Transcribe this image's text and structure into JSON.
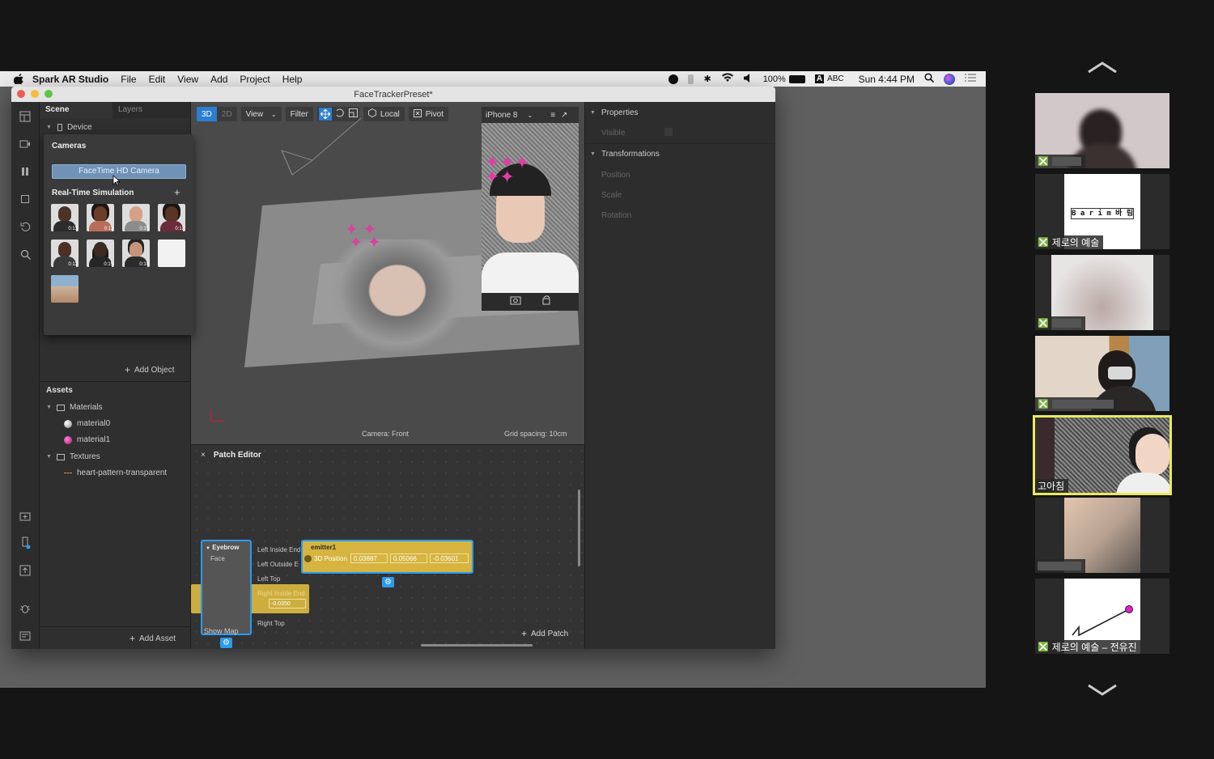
{
  "menubar": {
    "app_name": "Spark AR Studio",
    "menus": [
      "File",
      "Edit",
      "View",
      "Add",
      "Project",
      "Help"
    ],
    "battery": "100%",
    "input_method": "ABC",
    "clock": "Sun 4:44 PM"
  },
  "window": {
    "title": "FaceTrackerPreset*"
  },
  "scene_panel": {
    "tab_scene": "Scene",
    "tab_layers": "Layers",
    "device_label": "Device",
    "add_object": "Add Object"
  },
  "camera_popup": {
    "cameras_heading": "Cameras",
    "selected_camera": "FaceTime HD Camera",
    "simulation_heading": "Real-Time Simulation",
    "durations": [
      "0:13",
      "0:11",
      "0:15",
      "0:12",
      "0:12",
      "0:15",
      "0:10",
      ""
    ]
  },
  "assets": {
    "heading": "Assets",
    "materials_folder": "Materials",
    "material0": "material0",
    "material1": "material1",
    "textures_folder": "Textures",
    "texture0": "heart-pattern-transparent",
    "add_asset": "Add Asset"
  },
  "viewport": {
    "btn_3d": "3D",
    "btn_2d": "2D",
    "view": "View",
    "filter": "Filter",
    "local": "Local",
    "pivot": "Pivot",
    "device": "iPhone 8",
    "camera_label": "Camera: Front",
    "grid_label": "Grid spacing: 10cm"
  },
  "properties": {
    "heading": "Properties",
    "visible": "Visible",
    "transformations": "Transformations",
    "position": "Position",
    "scale": "Scale",
    "rotation": "Rotation"
  },
  "patch_editor": {
    "title": "Patch Editor",
    "eyebrow_node": "Eyebrow",
    "face_port": "Face",
    "ports": [
      "Left Inside End",
      "Left Outside E",
      "Left Top",
      "Right Inside End",
      "Right Top"
    ],
    "show_map": "Show Map",
    "emitter_node": "emitter1",
    "emitter_port": "3D Position",
    "emitter_values": [
      "0.03887",
      "0.05066",
      "-0.03601"
    ],
    "second_value": "-0.0350",
    "add_patch": "Add Patch"
  },
  "zoom_gallery": {
    "tiles": [
      {
        "name": "",
        "muted": true
      },
      {
        "name": "제로의 예술",
        "muted": true,
        "sign_text": "B a r i m 바 림"
      },
      {
        "name": "",
        "muted": true
      },
      {
        "name": "",
        "muted": true
      },
      {
        "name": "고아침",
        "muted": false,
        "active": true
      },
      {
        "name": "",
        "muted": false
      },
      {
        "name": "제로의 예술 – 전유진",
        "muted": true
      }
    ]
  },
  "colors": {
    "accent_blue": "#2b7fd2",
    "patch_yellow": "#d6b43f",
    "active_speaker": "#e7ea63",
    "mute_red": "#e0343b"
  }
}
